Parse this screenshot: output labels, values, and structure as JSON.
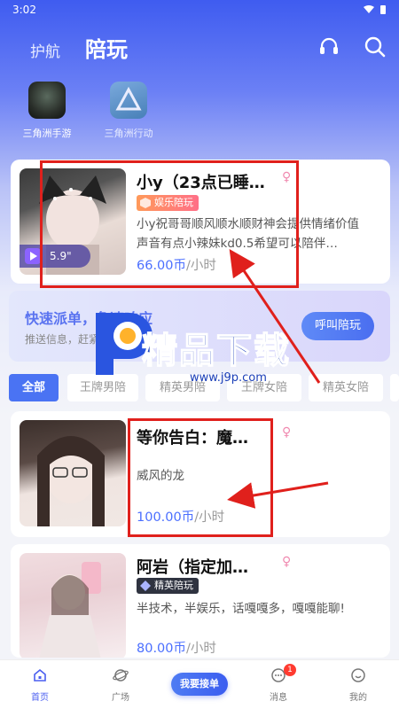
{
  "status": {
    "time": "3:02"
  },
  "nav": {
    "tab_escort": "护航",
    "tab_play": "陪玩"
  },
  "games": [
    {
      "label": "三角洲手游"
    },
    {
      "label": "三角洲行动"
    }
  ],
  "featured": {
    "name": "小y（23点已睡…",
    "gender": "♀",
    "tag": "娱乐陪玩",
    "voice_duration": "5.9\"",
    "desc": "小y祝哥哥顺风顺水顺财神会提供情绪价值声音有点小辣妹kd0.5希望可以陪伴…",
    "price": "66.00币",
    "unit": "/小时"
  },
  "banner": {
    "title": "快速派单，急速响应",
    "sub": "推送信息，赶紧有意向陪玩",
    "button": "呼叫陪玩"
  },
  "filters": [
    "全部",
    "王牌男陪",
    "精英男陪",
    "王牌女陪",
    "精英女陪"
  ],
  "listings": [
    {
      "name": "等你告白：魔…",
      "gender": "♀",
      "desc": "威风的龙",
      "price": "100.00币",
      "unit": "/小时"
    },
    {
      "name": "阿岩（指定加…",
      "gender": "♀",
      "tag": "精英陪玩",
      "desc": "半技术，半娱乐，话嘎嘎多，嘎嘎能聊!",
      "price": "80.00币",
      "unit": "/小时"
    }
  ],
  "watermark": {
    "text": "精品下载",
    "url": "www.j9p.com"
  },
  "bottom": {
    "home": "首页",
    "square": "广场",
    "accept": "我要接单",
    "messages": "消息",
    "messages_badge": "1",
    "mine": "我的"
  },
  "colors": {
    "accent": "#4a73f3",
    "price": "#4b6fff",
    "annotation": "#e0201c"
  }
}
